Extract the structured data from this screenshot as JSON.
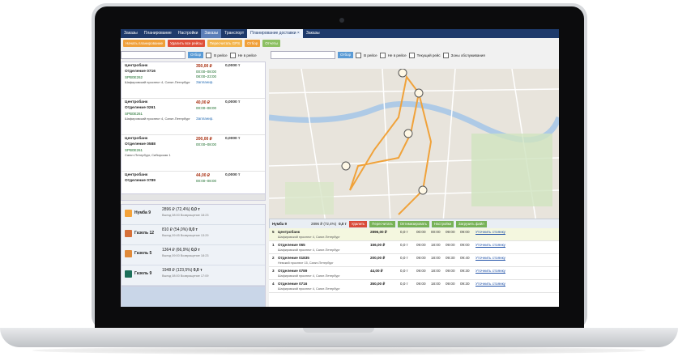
{
  "tabs": [
    {
      "label": "Заказы",
      "active": false
    },
    {
      "label": "Планирование",
      "active": false
    },
    {
      "label": "Настройки",
      "active": false
    },
    {
      "label": "Заказы",
      "active": false
    },
    {
      "label": "Транспорт",
      "active": false
    },
    {
      "label": "Планирование доставки",
      "active": true
    },
    {
      "label": "Заказы",
      "active": false
    }
  ],
  "toolbar": [
    "Начать планирование",
    "Удалить все рейсы",
    "Пересчитать GPS",
    "Отбор",
    "Отчеты"
  ],
  "filter_left": {
    "button": "Отбор",
    "checks": [
      "В рейсе",
      "Не в рейсе"
    ]
  },
  "filter_right": {
    "button": "Отбор",
    "checks": [
      "В рейсе",
      "Не в рейсе",
      "Текущий рейс",
      "Зоны обслуживания"
    ]
  },
  "stops": [
    {
      "name": "Центробанк",
      "sub": "Отделение 0716",
      "code": "SPB0E262",
      "addr": "Шафировский проспект 4, Санкт-Петербург",
      "amount": "350,00 ₽",
      "weight": "0,0000 т",
      "t1": "00:00–08:00",
      "t2": "08:00–23:00",
      "status": "Запланир."
    },
    {
      "name": "Центробанк",
      "sub": "Отделение 0261",
      "code": "SPB0E261",
      "addr": "Шафировский проспект 4, Санкт-Петербург",
      "amount": "40,00 ₽",
      "weight": "0,0000 т",
      "t1": "00:00–08:00",
      "t2": "",
      "status": "Запланир."
    },
    {
      "name": "Центробанк",
      "sub": "Отделение 0588",
      "code": "SPB0E261",
      "addr": "Санкт-Петербург, Сибирская 1",
      "amount": "200,00 ₽",
      "weight": "0,0000 т",
      "t1": "00:00–08:00",
      "t2": "",
      "status": ""
    },
    {
      "name": "Центробанк",
      "sub": "Отделение 0789",
      "code": "",
      "addr": "",
      "amount": "44,00 ₽",
      "weight": "0,0000 т",
      "t1": "00:00–08:00",
      "t2": "",
      "status": ""
    }
  ],
  "vehicles": [
    {
      "name": "Нумба 9",
      "value": "2896 ₽ (72,4%)",
      "weight": "0,0 т",
      "sub": "Выезд 08:00  Возвращение 18:23",
      "color": "#f3a23a"
    },
    {
      "name": "Газель 12",
      "value": "810 ₽ (54,0%)",
      "weight": "0,0 т",
      "sub": "Выезд 09:45  Возвращение 13:29",
      "color": "#d5703a"
    },
    {
      "name": "Газель 5",
      "value": "1364 ₽ (66,9%)",
      "weight": "0,0 т",
      "sub": "Выезд 09:00  Возвращение 18:23",
      "color": "#e08a3a"
    },
    {
      "name": "Газель 9",
      "value": "1948 ₽ (123,5%)",
      "weight": "0,0 т",
      "sub": "Выезд 08:00  Возвращение 17:09",
      "color": "#1c6f5a"
    }
  ],
  "route_bar": {
    "name": "Нумба 9",
    "value": "2896 ₽ (72,4%)",
    "weight": "0,0 т",
    "buttons": [
      "Удалить",
      "Пересчитать",
      "Оптимизировать",
      "Настройки",
      "Загрузить файл"
    ]
  },
  "route_rows": [
    {
      "n": "5",
      "name": "Центробанк",
      "addr": "Шафировский проспект 4, Санкт-Петербург",
      "amount": "2896,00 ₽",
      "weight": "0,0 т",
      "t1": "00:00",
      "t2": "00:00",
      "t3": "09:00",
      "t4": "09:00",
      "link": "Уточнить стоянку"
    },
    {
      "n": "1",
      "name": "Отделение 065",
      "addr": "Шафировский проспект 4, Санкт-Петербург",
      "amount": "156,00 ₽",
      "weight": "0,0 т",
      "t1": "09:00",
      "t2": "18:00",
      "t3": "09:00",
      "t4": "09:00",
      "link": "Уточнить стоянку"
    },
    {
      "n": "2",
      "name": "Отделение 01835",
      "addr": "Невский проспект 15, Санкт-Петербург",
      "amount": "200,00 ₽",
      "weight": "0,0 т",
      "t1": "09:00",
      "t2": "18:00",
      "t3": "09:30",
      "t4": "09:40",
      "link": "Уточнить стоянку"
    },
    {
      "n": "3",
      "name": "Отделение 0789",
      "addr": "Шафировский проспект 4, Санкт-Петербург",
      "amount": "44,00 ₽",
      "weight": "0,0 т",
      "t1": "09:00",
      "t2": "18:00",
      "t3": "09:00",
      "t4": "09:30",
      "link": "Уточнить стоянку"
    },
    {
      "n": "4",
      "name": "Отделение 0716",
      "addr": "Шафировский проспект 4, Санкт-Петербург",
      "amount": "350,00 ₽",
      "weight": "0,0 т",
      "t1": "09:00",
      "t2": "18:00",
      "t3": "09:00",
      "t4": "09:30",
      "link": "Уточнить стоянку"
    }
  ]
}
